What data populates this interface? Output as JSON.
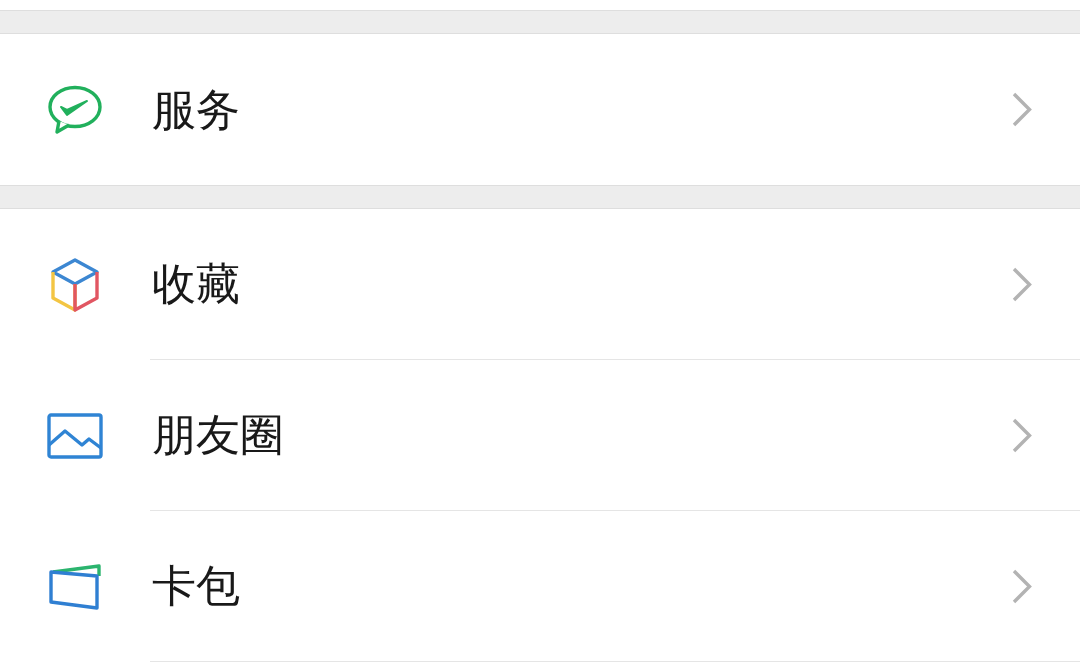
{
  "sections": [
    {
      "items": [
        {
          "label": "服务"
        }
      ]
    },
    {
      "items": [
        {
          "label": "收藏"
        },
        {
          "label": "朋友圈"
        },
        {
          "label": "卡包"
        }
      ]
    }
  ]
}
